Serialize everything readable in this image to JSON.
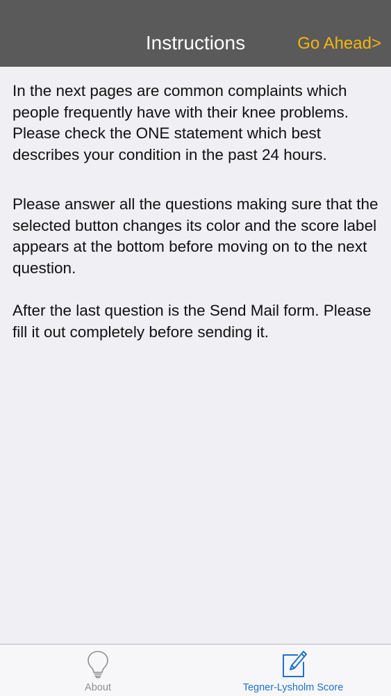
{
  "navbar": {
    "title": "Instructions",
    "right_button": "Go Ahead>"
  },
  "content": {
    "paragraphs": [
      "In the next pages are common complaints which people frequently have with their knee problems. Please check the ONE statement which best describes your condition in the past 24 hours.",
      "Please answer all the questions making sure that the selected button changes its color and the score label appears at the bottom before moving on to the next question.",
      "After the last question is the Send Mail form. Please fill it out completely before sending it."
    ]
  },
  "tabbar": {
    "tabs": [
      {
        "label": "About",
        "icon": "lightbulb-icon",
        "selected": false
      },
      {
        "label": "Tegner-Lysholm Score",
        "icon": "pencil-square-icon",
        "selected": true
      }
    ]
  },
  "colors": {
    "nav_background": "#5a5a5a",
    "accent_yellow": "#f5b70c",
    "tab_selected": "#1d72c9",
    "tab_unselected": "#8e8e93",
    "page_background": "#efeff4"
  }
}
